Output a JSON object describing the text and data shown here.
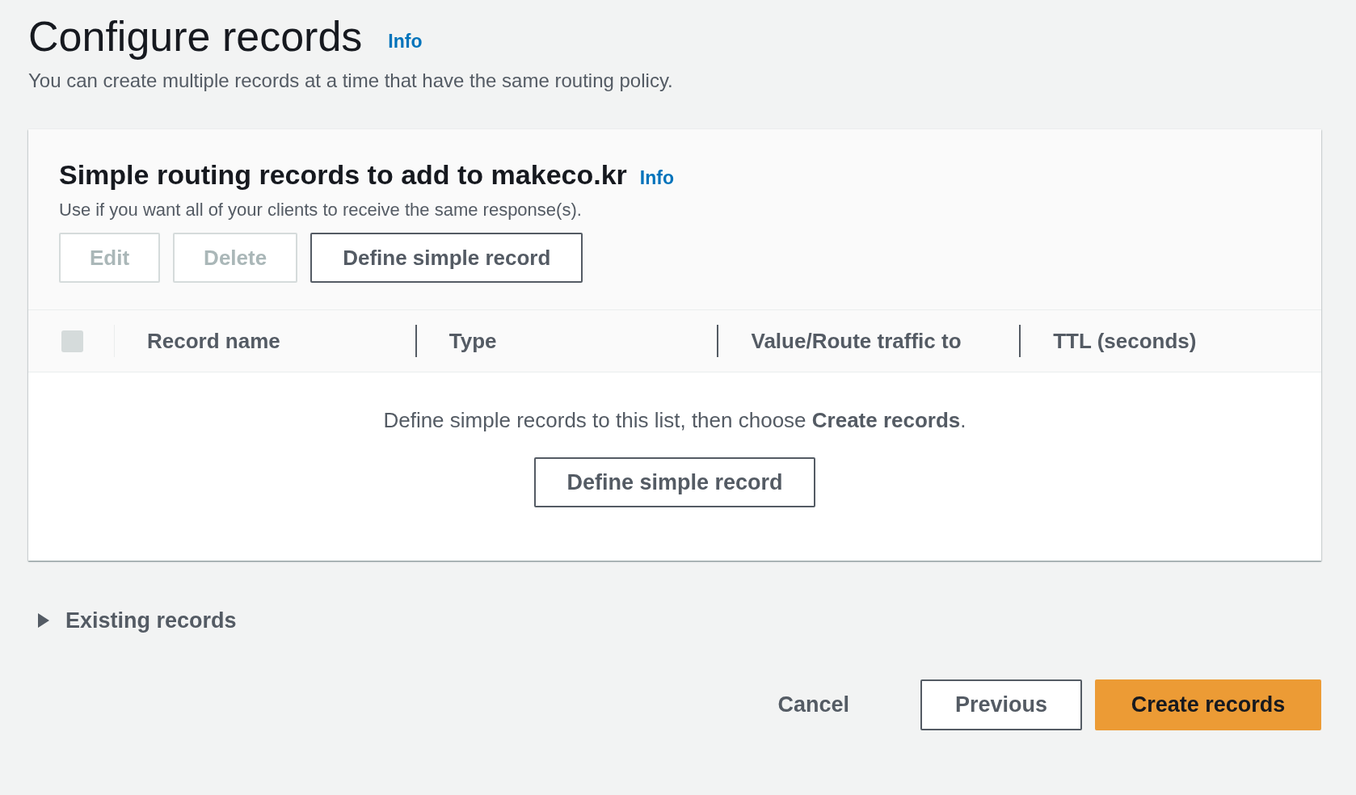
{
  "header": {
    "title": "Configure records",
    "info": "Info",
    "description": "You can create multiple records at a time that have the same routing policy."
  },
  "panel": {
    "title": "Simple routing records to add to makeco.kr",
    "info": "Info",
    "description": "Use if you want all of your clients to receive the same response(s).",
    "actions": [
      {
        "label": "Edit",
        "disabled": true
      },
      {
        "label": "Delete",
        "disabled": true
      },
      {
        "label": "Define simple record",
        "disabled": false
      }
    ],
    "table": {
      "select_all": {
        "checked": false,
        "disabled": true
      },
      "columns": [
        "Record name",
        "Type",
        "Value/Route traffic to",
        "TTL (seconds)"
      ],
      "empty_message": "Define simple records to this list, then choose **Create records**.",
      "empty_action": "Define simple record"
    }
  },
  "existing_records": {
    "label": "Existing records",
    "expanded": false
  },
  "footer": [
    {
      "label": "Cancel",
      "kind": "link"
    },
    {
      "label": "Previous",
      "kind": "normal"
    },
    {
      "label": "Create records",
      "kind": "primary"
    }
  ]
}
